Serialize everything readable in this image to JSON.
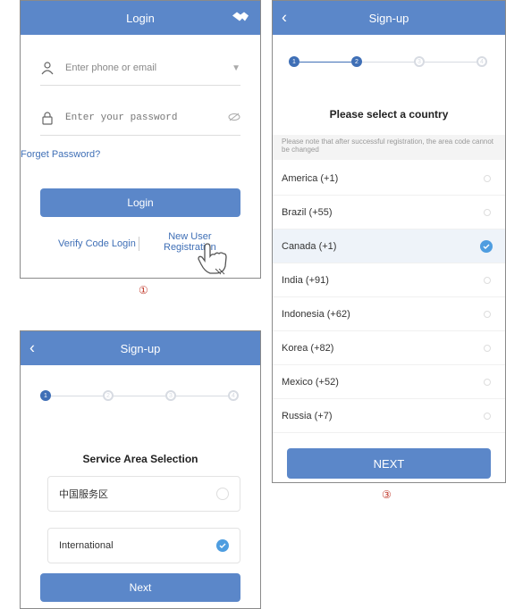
{
  "login": {
    "title": "Login",
    "phone_placeholder": "Enter phone or email",
    "password_placeholder": "Enter your password",
    "forget": "Forget Password?",
    "login_button": "Login",
    "verify_link": "Verify Code Login",
    "new_user_line1": "New User",
    "new_user_line2": "Registration",
    "marker": "①"
  },
  "signup_country": {
    "title": "Sign-up",
    "heading": "Please select a country",
    "note": "Please note that after successful registration, the area code cannot be changed",
    "countries": [
      {
        "label": "America (+1)",
        "selected": false
      },
      {
        "label": "Brazil (+55)",
        "selected": false
      },
      {
        "label": "Canada (+1)",
        "selected": true
      },
      {
        "label": "India (+91)",
        "selected": false
      },
      {
        "label": "Indonesia (+62)",
        "selected": false
      },
      {
        "label": "Korea (+82)",
        "selected": false
      },
      {
        "label": "Mexico (+52)",
        "selected": false
      },
      {
        "label": "Russia (+7)",
        "selected": false
      }
    ],
    "next_button": "NEXT",
    "marker": "③",
    "steps": [
      "1",
      "2",
      "3",
      "4"
    ],
    "current_step": 2
  },
  "signup_area": {
    "title": "Sign-up",
    "heading": "Service Area Selection",
    "options": [
      {
        "label": "中国服务区",
        "selected": false
      },
      {
        "label": "International",
        "selected": true
      }
    ],
    "next_button": "Next",
    "steps": [
      "1",
      "2",
      "3",
      "4"
    ],
    "current_step": 1
  },
  "colors": {
    "accent": "#5b87c9",
    "selected_radio": "#4e9de0",
    "marker": "#c0392b"
  }
}
